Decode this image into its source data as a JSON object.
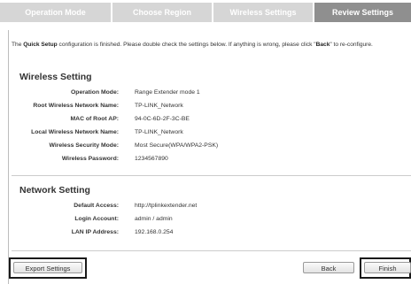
{
  "tabs": [
    {
      "label": "Operation Mode"
    },
    {
      "label": "Choose Region"
    },
    {
      "label": "Wireless Settings"
    },
    {
      "label": "Review Settings"
    }
  ],
  "intro": {
    "prefix": "The ",
    "bold1": "Quick Setup",
    "middle": " configuration is finished. Please double check the settings below. If anything is wrong, please click \"",
    "bold2": "Back",
    "suffix": "\" to re-configure."
  },
  "wireless": {
    "title": "Wireless Setting",
    "rows": [
      {
        "label": "Operation Mode:",
        "value": "Range Extender mode 1"
      },
      {
        "label": "Root Wireless Network Name:",
        "value": "TP-LINK_Network"
      },
      {
        "label": "MAC of Root AP:",
        "value": "94-0C-6D-2F-3C-BE"
      },
      {
        "label": "Local Wireless Network Name:",
        "value": "TP-LINK_Network"
      },
      {
        "label": "Wireless Security Mode:",
        "value": "Most Secure(WPA/WPA2-PSK)"
      },
      {
        "label": "Wireless Password:",
        "value": "1234567890"
      }
    ]
  },
  "network": {
    "title": "Network Setting",
    "rows": [
      {
        "label": "Default Access:",
        "value": "http://tplinkextender.net"
      },
      {
        "label": "Login Account:",
        "value": "admin /  admin"
      },
      {
        "label": "LAN IP Address:",
        "value": "192.168.0.254"
      }
    ]
  },
  "buttons": {
    "export": "Export Settings",
    "back": "Back",
    "finish": "Finish"
  }
}
